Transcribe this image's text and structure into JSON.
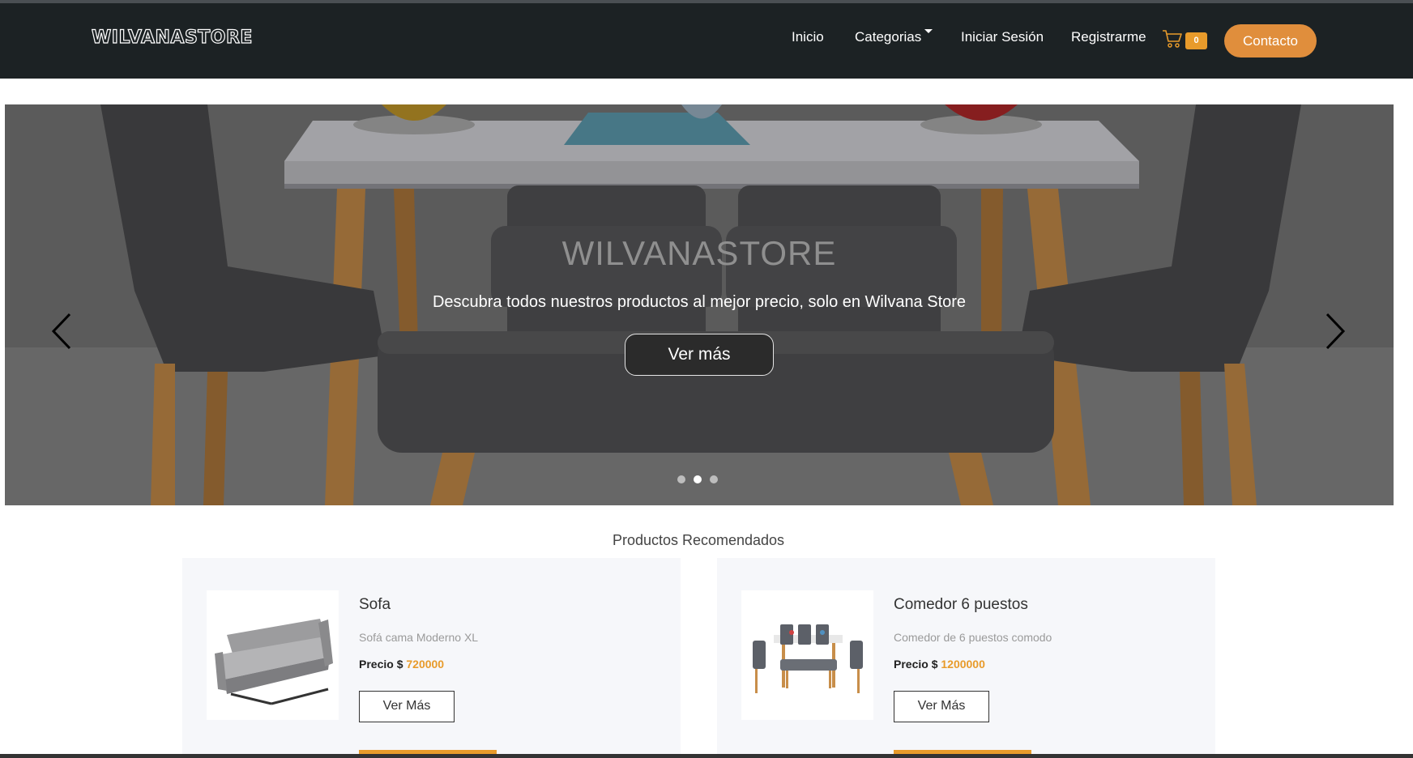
{
  "brand": "WILVANASTORE",
  "nav": {
    "inicio": "Inicio",
    "categorias": "Categorias",
    "login": "Iniciar Sesión",
    "register": "Registrarme",
    "cart_count": "0",
    "contact": "Contacto"
  },
  "hero": {
    "title": "WILVANASTORE",
    "subtitle": "Descubra todos nuestros productos al mejor precio, solo en Wilvana Store",
    "button": "Ver más",
    "active_slide": 2,
    "slides": 3
  },
  "products": {
    "section_title": "Productos Recomendados",
    "price_label": "Precio $",
    "items": [
      {
        "name": "Sofa",
        "description": "Sofá cama Moderno XL",
        "price": "720000",
        "button": "Ver Más"
      },
      {
        "name": "Comedor 6 puestos",
        "description": "Comedor de 6 puestos comodo",
        "price": "1200000",
        "button": "Ver Más"
      }
    ]
  },
  "colors": {
    "navbar": "#1c2224",
    "accent": "#e89b2b",
    "contact_button": "#e08e3c",
    "card_bg": "#f6f7fa"
  },
  "icons": [
    "cart-icon",
    "chevron-left-icon",
    "chevron-right-icon",
    "caret-down-icon"
  ]
}
